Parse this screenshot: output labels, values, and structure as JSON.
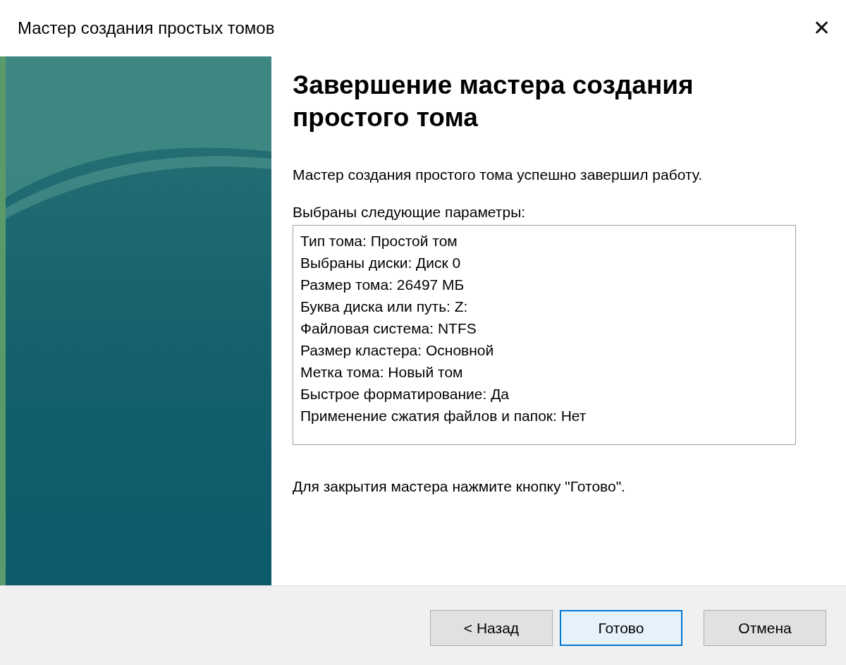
{
  "window": {
    "title": "Мастер создания простых томов",
    "close": "✕"
  },
  "heading": "Завершение мастера создания простого тома",
  "intro": "Мастер создания простого тома успешно завершил работу.",
  "settings_label": "Выбраны следующие параметры:",
  "settings": [
    "Тип тома: Простой том",
    "Выбраны диски: Диск 0",
    "Размер тома: 26497 МБ",
    "Буква диска или путь: Z:",
    "Файловая система: NTFS",
    "Размер кластера: Основной",
    "Метка тома: Новый том",
    "Быстрое форматирование: Да",
    "Применение сжатия файлов и папок: Нет"
  ],
  "footer_note": "Для закрытия мастера нажмите кнопку \"Готово\".",
  "buttons": [
    {
      "label": "< Назад",
      "focused": false
    },
    {
      "label": "Готово",
      "focused": true
    },
    {
      "label": "Отмена",
      "focused": false
    }
  ]
}
